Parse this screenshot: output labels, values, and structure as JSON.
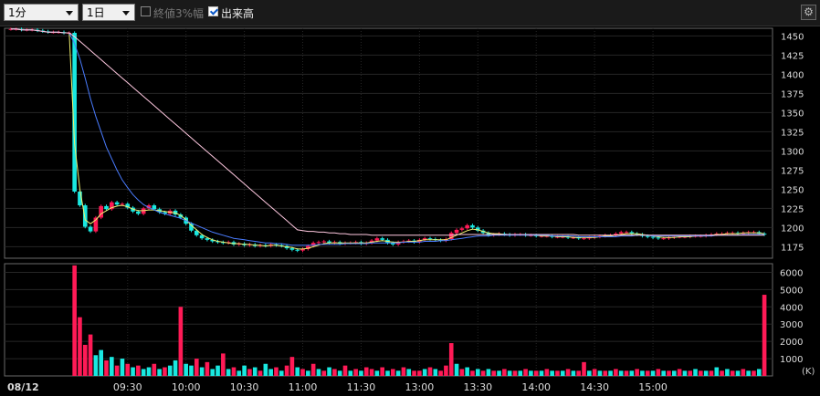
{
  "toolbar": {
    "interval_value": "1分",
    "period_value": "1日",
    "option_limit_label": "終値3%幅",
    "option_limit_checked": false,
    "option_volume_label": "出来高",
    "option_volume_checked": true,
    "settings_icon": "gear-icon"
  },
  "colors": {
    "up": "#ff1a56",
    "down": "#19e8e0",
    "ma_short": "#f0f070",
    "ma_mid": "#4a7cff",
    "ma_long": "#ffc8e0",
    "grid": "#262626",
    "axis": "#6a6a6a"
  },
  "chart_data": [
    {
      "type": "candlestick",
      "date_label": "08/12",
      "x_tick_labels": [
        "09:30",
        "10:00",
        "10:30",
        "11:00",
        "11:30",
        "13:00",
        "13:30",
        "14:00",
        "14:30",
        "15:00"
      ],
      "y_tick_labels": [
        "1450",
        "1425",
        "1400",
        "1375",
        "1350",
        "1325",
        "1300",
        "1275",
        "1250",
        "1225",
        "1200",
        "1175"
      ],
      "ylim": [
        1160,
        1460
      ],
      "grid": true,
      "close_series": [
        1459,
        1459,
        1458,
        1458,
        1458,
        1457,
        1456,
        1455,
        1455,
        1455,
        1454,
        1454,
        1247,
        1229,
        1201,
        1195,
        1213,
        1228,
        1224,
        1233,
        1230,
        1231,
        1226,
        1221,
        1218,
        1225,
        1229,
        1224,
        1220,
        1218,
        1222,
        1217,
        1213,
        1205,
        1196,
        1190,
        1186,
        1184,
        1182,
        1181,
        1180,
        1181,
        1178,
        1179,
        1177,
        1178,
        1176,
        1177,
        1176,
        1178,
        1177,
        1176,
        1173,
        1171,
        1170,
        1172,
        1176,
        1180,
        1181,
        1182,
        1180,
        1181,
        1179,
        1180,
        1180,
        1181,
        1179,
        1180,
        1183,
        1186,
        1184,
        1180,
        1178,
        1181,
        1182,
        1183,
        1181,
        1184,
        1186,
        1185,
        1184,
        1183,
        1185,
        1193,
        1197,
        1199,
        1203,
        1200,
        1196,
        1193,
        1190,
        1191,
        1192,
        1191,
        1190,
        1191,
        1191,
        1190,
        1190,
        1189,
        1189,
        1189,
        1188,
        1188,
        1188,
        1187,
        1187,
        1186,
        1186,
        1187,
        1188,
        1189,
        1190,
        1190,
        1192,
        1194,
        1194,
        1192,
        1191,
        1189,
        1188,
        1187,
        1186,
        1186,
        1187,
        1188,
        1188,
        1188,
        1189,
        1189,
        1189,
        1190,
        1191,
        1192,
        1192,
        1193,
        1193,
        1192,
        1193,
        1194,
        1194,
        1192,
        1191
      ],
      "moving_averages": [
        {
          "color": "#f0f070",
          "values": [
            1459,
            1459,
            1458,
            1458,
            1458,
            1457,
            1456,
            1455,
            1455,
            1455,
            1454,
            1454,
            1310,
            1250,
            1210,
            1205,
            1210,
            1218,
            1222,
            1226,
            1228,
            1229,
            1227,
            1224,
            1222,
            1222,
            1223,
            1223,
            1222,
            1221,
            1220,
            1219,
            1216,
            1210,
            1203,
            1197,
            1191,
            1187,
            1184,
            1182,
            1181,
            1180,
            1179,
            1179,
            1178,
            1178,
            1177,
            1177,
            1176,
            1177,
            1177,
            1176,
            1175,
            1174,
            1172,
            1172,
            1173,
            1175,
            1177,
            1179,
            1180,
            1180,
            1180,
            1180,
            1180,
            1180,
            1180,
            1180,
            1181,
            1182,
            1183,
            1182,
            1181,
            1181,
            1181,
            1182,
            1182,
            1183,
            1184,
            1184,
            1184,
            1184,
            1184,
            1187,
            1190,
            1193,
            1196,
            1198,
            1197,
            1195,
            1193,
            1192,
            1192,
            1191,
            1191,
            1191,
            1191,
            1190,
            1190,
            1190,
            1189,
            1189,
            1189,
            1188,
            1188,
            1188,
            1187,
            1187,
            1187,
            1187,
            1187,
            1188,
            1189,
            1189,
            1190,
            1191,
            1192,
            1192,
            1192,
            1191,
            1190,
            1189,
            1188,
            1187,
            1187,
            1187,
            1188,
            1188,
            1188,
            1189,
            1189,
            1189,
            1190,
            1191,
            1191,
            1192,
            1192,
            1192,
            1193,
            1193,
            1193,
            1193,
            1192
          ]
        },
        {
          "color": "#4a7cff",
          "values": [
            1459,
            1459,
            1458,
            1458,
            1458,
            1457,
            1456,
            1455,
            1455,
            1455,
            1454,
            1454,
            1440,
            1420,
            1395,
            1368,
            1345,
            1325,
            1305,
            1290,
            1275,
            1262,
            1252,
            1243,
            1236,
            1230,
            1226,
            1223,
            1220,
            1218,
            1216,
            1214,
            1212,
            1209,
            1206,
            1203,
            1200,
            1197,
            1194,
            1192,
            1190,
            1188,
            1186,
            1185,
            1184,
            1183,
            1182,
            1181,
            1180,
            1180,
            1179,
            1179,
            1178,
            1177,
            1177,
            1177,
            1177,
            1177,
            1178,
            1178,
            1178,
            1178,
            1178,
            1179,
            1179,
            1179,
            1179,
            1179,
            1180,
            1180,
            1180,
            1180,
            1180,
            1180,
            1181,
            1181,
            1181,
            1181,
            1182,
            1182,
            1182,
            1183,
            1183,
            1184,
            1185,
            1186,
            1187,
            1188,
            1189,
            1189,
            1189,
            1190,
            1190,
            1190,
            1190,
            1190,
            1190,
            1190,
            1190,
            1190,
            1190,
            1190,
            1189,
            1189,
            1189,
            1189,
            1189,
            1188,
            1188,
            1188,
            1188,
            1188,
            1188,
            1188,
            1188,
            1189,
            1189,
            1189,
            1190,
            1190,
            1190,
            1189,
            1189,
            1189,
            1189,
            1189,
            1189,
            1189,
            1189,
            1189,
            1189,
            1189,
            1189,
            1190,
            1190,
            1190,
            1190,
            1190,
            1191,
            1191,
            1191,
            1191,
            1191
          ]
        },
        {
          "color": "#ffc8e0",
          "values": [
            1459,
            1459,
            1458,
            1458,
            1458,
            1457,
            1456,
            1455,
            1455,
            1455,
            1454,
            1454,
            1449,
            1443,
            1437,
            1431,
            1425,
            1419,
            1413,
            1407,
            1401,
            1395,
            1389,
            1383,
            1377,
            1371,
            1365,
            1359,
            1353,
            1347,
            1341,
            1335,
            1329,
            1323,
            1317,
            1311,
            1305,
            1299,
            1293,
            1287,
            1281,
            1275,
            1269,
            1263,
            1257,
            1251,
            1245,
            1239,
            1233,
            1227,
            1221,
            1215,
            1209,
            1203,
            1197,
            1196,
            1195,
            1195,
            1194,
            1194,
            1193,
            1193,
            1192,
            1192,
            1191,
            1191,
            1191,
            1191,
            1190,
            1190,
            1190,
            1190,
            1190,
            1190,
            1190,
            1190,
            1190,
            1190,
            1190,
            1190,
            1190,
            1190,
            1190,
            1190,
            1191,
            1191,
            1191,
            1191,
            1191,
            1191,
            1191,
            1191,
            1191,
            1191,
            1191,
            1191,
            1191,
            1191,
            1191,
            1191,
            1191,
            1191,
            1191,
            1191,
            1191,
            1191,
            1191,
            1190,
            1190,
            1190,
            1190,
            1190,
            1190,
            1190,
            1190,
            1190,
            1190,
            1190,
            1190,
            1190,
            1190,
            1190,
            1190,
            1190,
            1190,
            1190,
            1190,
            1190,
            1190,
            1190,
            1190,
            1190,
            1190,
            1190,
            1190,
            1190,
            1190,
            1190,
            1190,
            1190,
            1190,
            1190,
            1190
          ]
        }
      ]
    },
    {
      "type": "bar",
      "title": "出来高",
      "unit_label": "(K)",
      "y_tick_labels": [
        "6000",
        "5000",
        "4000",
        "3000",
        "2000",
        "1000"
      ],
      "ylim": [
        0,
        6500
      ],
      "values": [
        0,
        0,
        0,
        0,
        0,
        0,
        0,
        0,
        0,
        0,
        0,
        0,
        6400,
        3400,
        1800,
        2400,
        1200,
        1500,
        900,
        1100,
        600,
        1000,
        700,
        500,
        600,
        400,
        500,
        700,
        400,
        500,
        600,
        900,
        4000,
        700,
        600,
        1000,
        500,
        800,
        400,
        600,
        1300,
        400,
        500,
        300,
        600,
        400,
        500,
        300,
        700,
        400,
        500,
        300,
        600,
        1100,
        500,
        400,
        300,
        700,
        400,
        300,
        500,
        400,
        300,
        600,
        300,
        400,
        300,
        500,
        400,
        300,
        500,
        300,
        400,
        300,
        500,
        400,
        300,
        300,
        400,
        500,
        400,
        300,
        600,
        1900,
        700,
        400,
        500,
        300,
        400,
        300,
        400,
        300,
        300,
        400,
        300,
        300,
        300,
        400,
        300,
        300,
        300,
        400,
        300,
        300,
        300,
        400,
        300,
        300,
        800,
        300,
        400,
        300,
        300,
        300,
        400,
        300,
        300,
        300,
        400,
        300,
        300,
        300,
        400,
        300,
        300,
        300,
        400,
        300,
        300,
        400,
        300,
        300,
        300,
        500,
        300,
        400,
        300,
        300,
        400,
        300,
        300,
        400,
        4700
      ],
      "directions": [
        "up",
        "up",
        "up",
        "up",
        "up",
        "up",
        "up",
        "up",
        "up",
        "up",
        "up",
        "up",
        "up",
        "up",
        "up",
        "up",
        "down",
        "down",
        "up",
        "down",
        "up",
        "down",
        "up",
        "down",
        "up",
        "down",
        "down",
        "up",
        "down",
        "up",
        "down",
        "down",
        "up",
        "down",
        "down",
        "up",
        "down",
        "up",
        "down",
        "down",
        "up",
        "down",
        "up",
        "down",
        "down",
        "up",
        "down",
        "up",
        "down",
        "down",
        "up",
        "down",
        "up",
        "up",
        "down",
        "up",
        "down",
        "up",
        "down",
        "up",
        "down",
        "up",
        "down",
        "up",
        "down",
        "up",
        "down",
        "up",
        "up",
        "down",
        "up",
        "down",
        "up",
        "down",
        "up",
        "down",
        "up",
        "up",
        "down",
        "up",
        "down",
        "up",
        "up",
        "up",
        "down",
        "up",
        "down",
        "up",
        "down",
        "up",
        "down",
        "up",
        "down",
        "up",
        "down",
        "up",
        "down",
        "up",
        "down",
        "up",
        "down",
        "up",
        "down",
        "up",
        "down",
        "up",
        "down",
        "up",
        "up",
        "down",
        "up",
        "down",
        "up",
        "down",
        "up",
        "down",
        "up",
        "down",
        "up",
        "down",
        "up",
        "down",
        "up",
        "down",
        "up",
        "down",
        "up",
        "down",
        "up",
        "down",
        "up",
        "down",
        "up",
        "down",
        "up",
        "down",
        "up",
        "down",
        "up",
        "down",
        "up",
        "down",
        "up"
      ]
    }
  ]
}
